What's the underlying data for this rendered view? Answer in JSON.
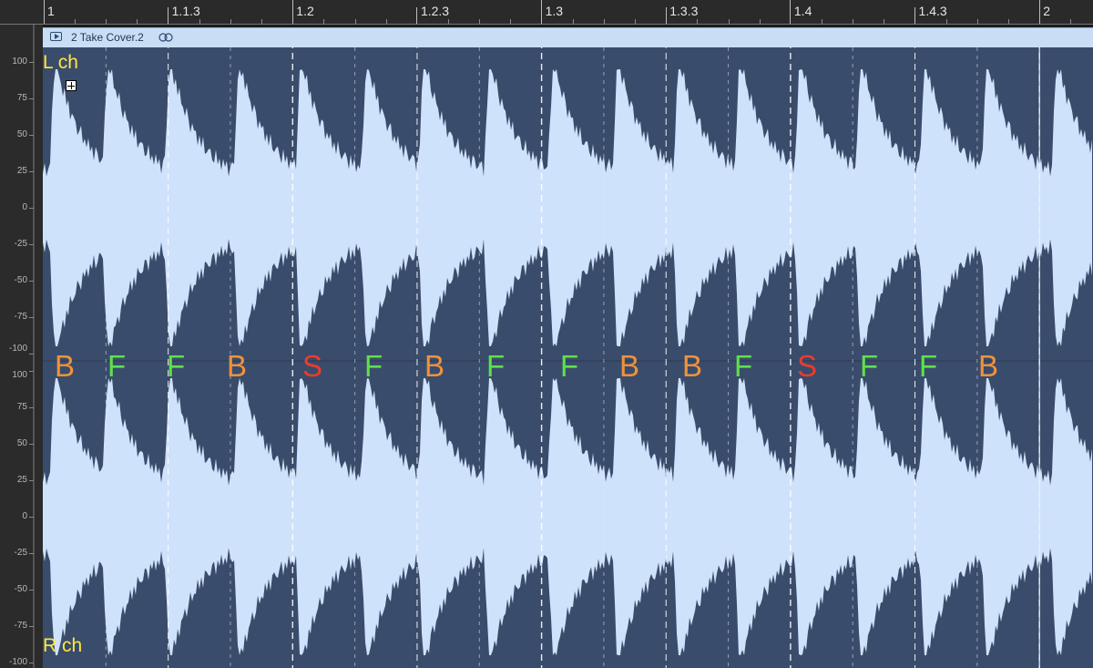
{
  "ruler": {
    "markers": [
      "1",
      "1.1.3",
      "1.2",
      "1.2.3",
      "1.3",
      "1.3.3",
      "1.4",
      "1.4.3",
      "2"
    ]
  },
  "region": {
    "title": "2 Take Cover.2"
  },
  "channels": {
    "left_label": "L ch",
    "right_label": "R ch"
  },
  "amplitude_ticks": [
    "100",
    "75",
    "50",
    "25",
    "0",
    "-25",
    "-50",
    "-75",
    "-100"
  ],
  "drum_hits": [
    {
      "label": "B",
      "color": "#f0923a"
    },
    {
      "label": "F",
      "color": "#5ee04a"
    },
    {
      "label": "F",
      "color": "#5ee04a"
    },
    {
      "label": "B",
      "color": "#f0923a"
    },
    {
      "label": "S",
      "color": "#ee3b2c"
    },
    {
      "label": "F",
      "color": "#5ee04a"
    },
    {
      "label": "B",
      "color": "#f0923a"
    },
    {
      "label": "F",
      "color": "#5ee04a"
    },
    {
      "label": "F",
      "color": "#5ee04a"
    },
    {
      "label": "B",
      "color": "#f0923a"
    },
    {
      "label": "B",
      "color": "#f0923a"
    },
    {
      "label": "F",
      "color": "#5ee04a"
    },
    {
      "label": "S",
      "color": "#ee3b2c"
    },
    {
      "label": "F",
      "color": "#5ee04a"
    },
    {
      "label": "F",
      "color": "#5ee04a"
    },
    {
      "label": "B",
      "color": "#f0923a"
    }
  ],
  "colors": {
    "waveform_fill": "#cfe2fb",
    "region_background": "#3a4c6b",
    "channel_label": "#ffe640"
  }
}
